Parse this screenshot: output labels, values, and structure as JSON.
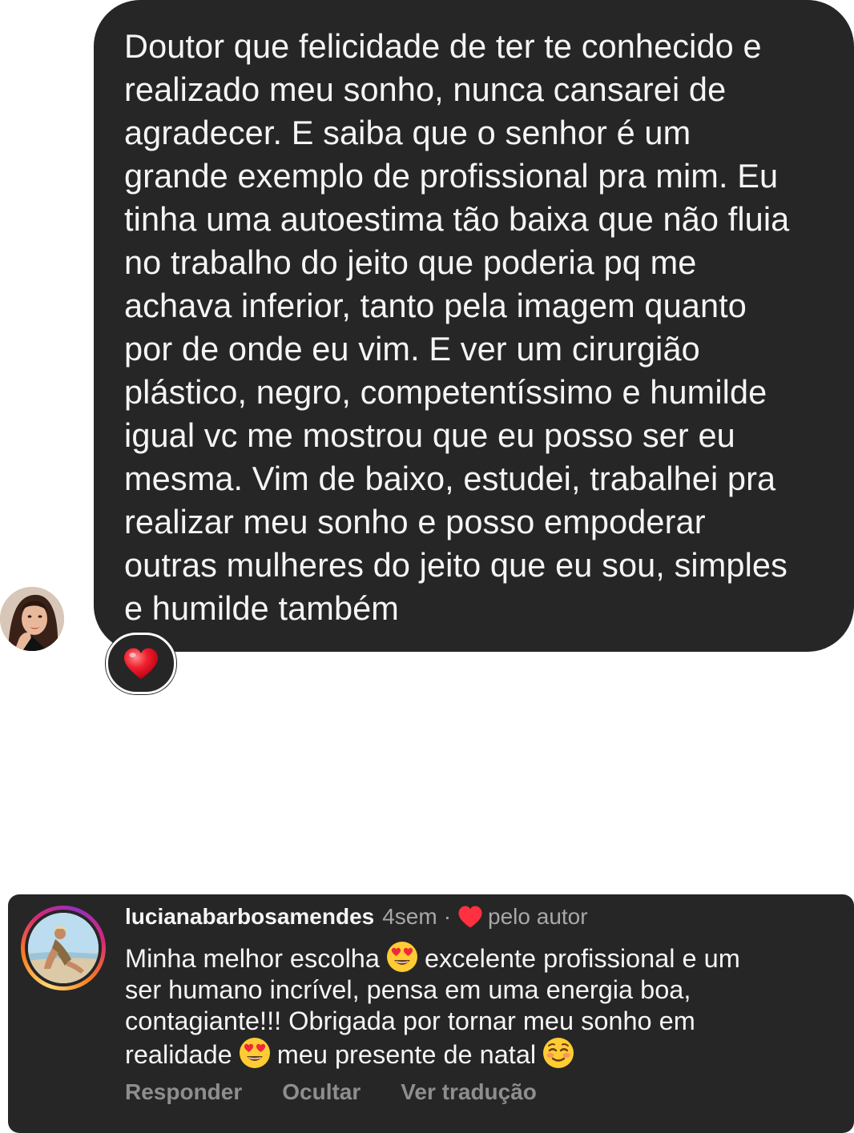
{
  "dm": {
    "message_lines": [
      "Doutor que felicidade de ter te conhecido e",
      "realizado meu sonho, nunca cansarei de",
      "agradecer. E saiba que o senhor é um",
      "grande exemplo de profissional pra mim. Eu",
      "tinha uma autoestima tão baixa que não fluia",
      "no trabalho do jeito que poderia pq me",
      "achava inferior, tanto pela imagem quanto",
      "por de onde eu vim. E ver um cirurgião",
      "plástico, negro, competentíssimo e humilde",
      "igual vc me mostrou que eu posso ser eu",
      "mesma. Vim de baixo, estudei, trabalhei pra",
      "realizar meu sonho e posso empoderar",
      "outras mulheres do jeito que eu sou, simples",
      "e humilde também"
    ],
    "reaction": "heart-emoji",
    "bubble_color": "#262626"
  },
  "comment": {
    "username": "lucianabarbosamendes",
    "time": "4sem",
    "separator": "·",
    "liked_by_author": "pelo autor",
    "text_segment_1": "Minha melhor escolha",
    "emoji_1": "heart-eyes-emoji",
    "text_segment_2": "excelente profissional e um\nser humano incrível, pensa em uma energia boa,\ncontagiante!!! Obrigada por tornar meu sonho em\nrealidade",
    "emoji_2": "heart-eyes-emoji",
    "text_segment_3": "meu presente de natal",
    "emoji_3": "smiling-blush-emoji",
    "actions": {
      "reply": "Responder",
      "hide": "Ocultar",
      "translate": "Ver tradução"
    },
    "heart_color": "#ff3040"
  }
}
